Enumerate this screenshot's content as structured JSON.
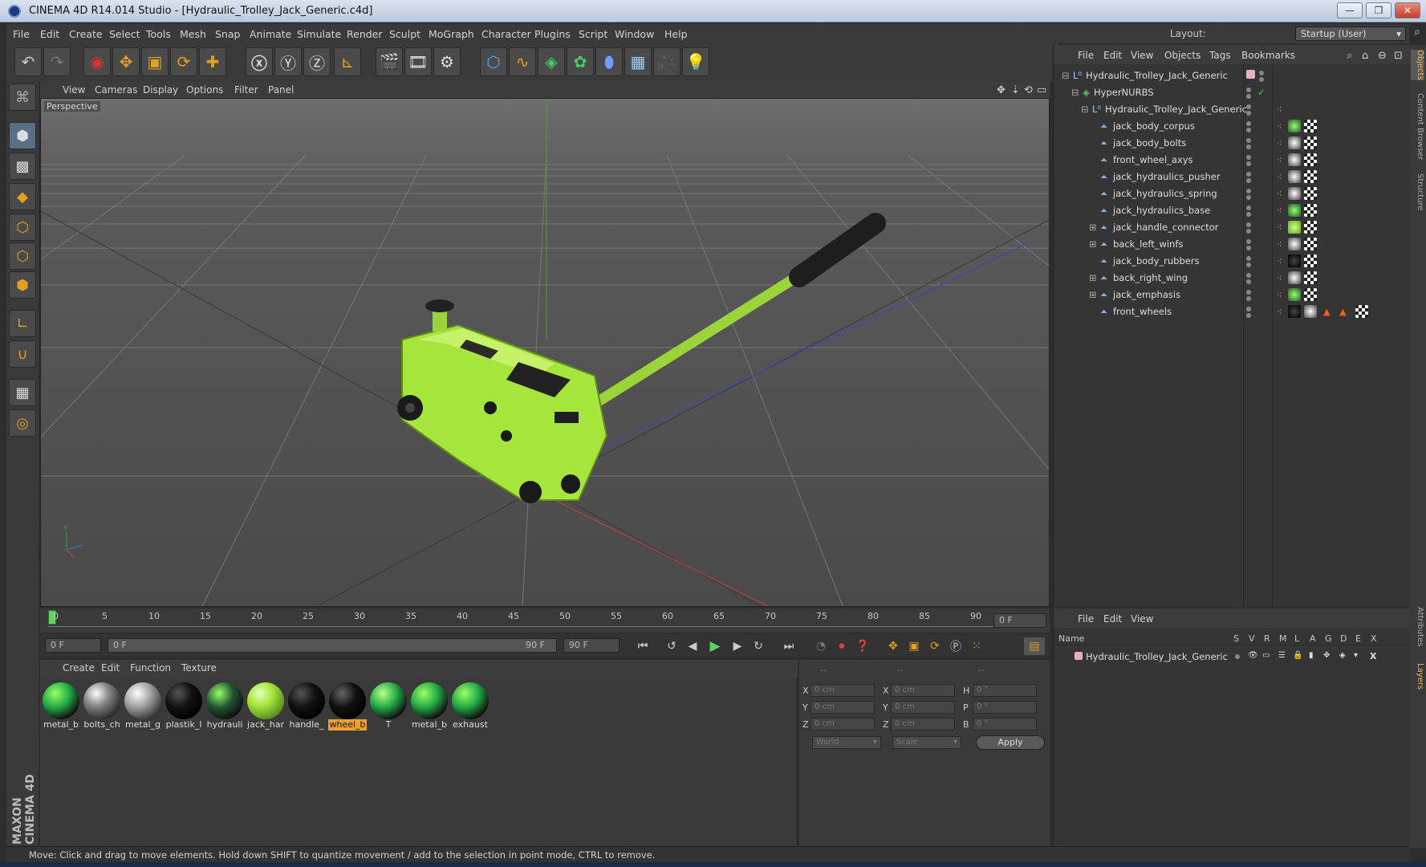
{
  "window": {
    "title": "CINEMA 4D R14.014 Studio - [Hydraulic_Trolley_Jack_Generic.c4d]",
    "minimize": "—",
    "maximize": "❐",
    "close": "✕"
  },
  "menubar": [
    "File",
    "Edit",
    "Create",
    "Select",
    "Tools",
    "Mesh",
    "Snap",
    "Animate",
    "Simulate",
    "Render",
    "Sculpt",
    "MoGraph",
    "Character",
    "Plugins",
    "Script",
    "Window",
    "Help"
  ],
  "layout": {
    "label": "Layout:",
    "value": "Startup (User)"
  },
  "viewport": {
    "menu": [
      "View",
      "Cameras",
      "Display",
      "Options",
      "Filter",
      "Panel"
    ],
    "label": "Perspective"
  },
  "timeline": {
    "ticks": [
      "0",
      "5",
      "10",
      "15",
      "20",
      "25",
      "30",
      "35",
      "40",
      "45",
      "50",
      "55",
      "60",
      "65",
      "70",
      "75",
      "80",
      "85",
      "90"
    ],
    "current_frame": "0 F",
    "start_field": "0 F",
    "range_start": "0 F",
    "range_end": "90 F",
    "end_field": "90 F"
  },
  "materials": {
    "menu": [
      "Create",
      "Edit",
      "Function",
      "Texture"
    ],
    "items": [
      {
        "label": "metal_b"
      },
      {
        "label": "bolts_ch"
      },
      {
        "label": "metal_g"
      },
      {
        "label": "plastik_l"
      },
      {
        "label": "hydrauli"
      },
      {
        "label": "jack_har"
      },
      {
        "label": "handle_"
      },
      {
        "label": "wheel_b"
      },
      {
        "label": "T"
      },
      {
        "label": "metal_b"
      },
      {
        "label": "exhaust"
      }
    ]
  },
  "coords": {
    "headers": [
      "--",
      "--",
      "--"
    ],
    "rows": [
      {
        "a": "X",
        "av": "0 cm",
        "b": "X",
        "bv": "0 cm",
        "c": "H",
        "cv": "0 °"
      },
      {
        "a": "Y",
        "av": "0 cm",
        "b": "Y",
        "bv": "0 cm",
        "c": "P",
        "cv": "0 °"
      },
      {
        "a": "Z",
        "av": "0 cm",
        "b": "Z",
        "bv": "0 cm",
        "c": "B",
        "cv": "0 °"
      }
    ],
    "world": "World",
    "scale": "Scale",
    "apply": "Apply"
  },
  "objects": {
    "menu": [
      "File",
      "Edit",
      "View",
      "Objects",
      "Tags",
      "Bookmarks"
    ],
    "tree": [
      {
        "name": "Hydraulic_Trolley_Jack_Generic"
      },
      {
        "name": "HyperNURBS"
      },
      {
        "name": "Hydraulic_Trolley_Jack_Generic"
      },
      {
        "name": "jack_body_corpus"
      },
      {
        "name": "jack_body_bolts"
      },
      {
        "name": "front_wheel_axys"
      },
      {
        "name": "jack_hydraulics_pusher"
      },
      {
        "name": "jack_hydraulics_spring"
      },
      {
        "name": "jack_hydraulics_base"
      },
      {
        "name": "jack_handle_connector"
      },
      {
        "name": "back_left_winfs"
      },
      {
        "name": "jack_body_rubbers"
      },
      {
        "name": "back_right_wing"
      },
      {
        "name": "jack_emphasis"
      },
      {
        "name": "front_wheels"
      }
    ]
  },
  "attributes": {
    "menu": [
      "File",
      "Edit",
      "View"
    ],
    "columns": {
      "name": "Name",
      "flags": [
        "S",
        "V",
        "R",
        "M",
        "L",
        "A",
        "G",
        "D",
        "E",
        "X"
      ]
    },
    "row": "Hydraulic_Trolley_Jack_Generic"
  },
  "right_tabs": [
    "Objects",
    "Content Browser",
    "Structure",
    "Attributes",
    "Layers"
  ],
  "status": "Move: Click and drag to move elements. Hold down SHIFT to quantize movement / add to the selection in point mode, CTRL to remove.",
  "brand": {
    "text": "MAXON CINEMA 4D"
  },
  "colors": {
    "accent": "#f0a030",
    "jack_green": "#a6e63c",
    "panel": "#3a3a3a"
  }
}
